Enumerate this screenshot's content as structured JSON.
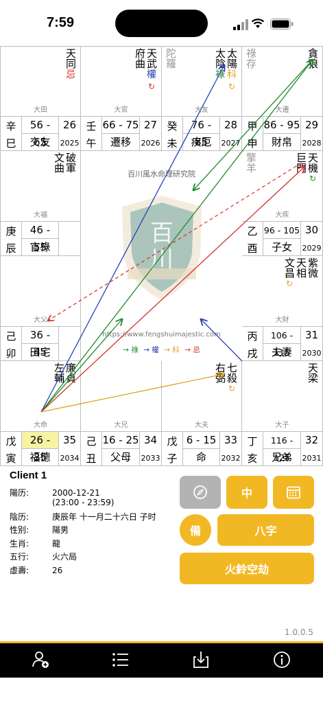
{
  "status": {
    "time": "7:59"
  },
  "center": {
    "institute": "百川風水命理研究院",
    "url": "https://www.fengshuimajestic.com",
    "legend": [
      {
        "text": "→ 祿",
        "color": "#1f8a2a"
      },
      {
        "text": "→ 權",
        "color": "#2740b8"
      },
      {
        "text": "→ 科",
        "color": "#e0a020"
      },
      {
        "text": "→ 忌",
        "color": "#d0312d"
      }
    ]
  },
  "palaces": {
    "si": {
      "stars": [
        {
          "ch": "天同",
          "mod": "忌",
          "modc": "ji"
        }
      ],
      "minor": [],
      "da": "大田",
      "gan": "辛",
      "zhi": "巳",
      "range": "56 - 65",
      "age": "26",
      "name": "交友",
      "year": "2025"
    },
    "wu": {
      "stars": [
        {
          "ch": "府曲",
          "mod": "",
          "modc": ""
        },
        {
          "ch": "天武",
          "mod": "權",
          "modc": "quan",
          "ref": "↻"
        }
      ],
      "minor": [],
      "da": "大官",
      "gan": "壬",
      "zhi": "午",
      "range": "66 - 75",
      "age": "27",
      "name": "遷移",
      "year": "2026"
    },
    "wei": {
      "stars": [
        {
          "ch": "太陰",
          "mod": "祿",
          "modc": "lu"
        },
        {
          "ch": "太陽",
          "mod": "科",
          "modc": "ke",
          "ref": "↻"
        }
      ],
      "minor": [
        {
          "ch": "陀羅"
        }
      ],
      "da": "大友",
      "gan": "癸",
      "zhi": "未",
      "range": "76 - 85",
      "age": "28",
      "name": "疾厄",
      "year": "2027"
    },
    "shen": {
      "stars": [
        {
          "ch": "貪狼",
          "mod": "",
          "modc": ""
        }
      ],
      "minor": [
        {
          "ch": "祿存"
        }
      ],
      "da": "大遷",
      "gan": "甲",
      "zhi": "申",
      "range": "86 - 95",
      "age": "29",
      "name": "財帛",
      "year": "2028"
    },
    "chen": {
      "stars": [
        {
          "ch": "文曲",
          "mod": "",
          "modc": ""
        },
        {
          "ch": "破軍",
          "mod": "",
          "modc": ""
        }
      ],
      "minor": [],
      "da": "大福",
      "gan": "庚",
      "zhi": "辰",
      "range": "46 - 55",
      "age": "",
      "name": "官祿",
      "year": ""
    },
    "you": {
      "stars": [
        {
          "ch": "巨門",
          "mod": "",
          "modc": ""
        },
        {
          "ch": "天機",
          "mod": "",
          "modc": "",
          "ref": "↻"
        }
      ],
      "minor": [
        {
          "ch": "擎羊"
        }
      ],
      "da": "大疾",
      "gan": "乙",
      "zhi": "酉",
      "range": "96 - 105",
      "age": "30",
      "name": "子女",
      "year": "2029"
    },
    "mao": {
      "stars": [],
      "minor": [],
      "da": "大父",
      "gan": "己",
      "zhi": "卯",
      "range": "36 - 45",
      "age": "",
      "name": "田宅",
      "year": ""
    },
    "xu": {
      "stars": [
        {
          "ch": "紫微",
          "mod": "",
          "modc": ""
        },
        {
          "ch": "天相",
          "mod": "",
          "modc": ""
        },
        {
          "ch": "文昌",
          "mod": "",
          "modc": "",
          "ref": "↻"
        }
      ],
      "minor": [],
      "da": "大財",
      "gan": "丙",
      "zhi": "戌",
      "range": "106 - 115",
      "age": "31",
      "name": "夫妻",
      "year": "2030"
    },
    "yin": {
      "stars": [
        {
          "ch": "廉貞",
          "mod": "",
          "modc": ""
        },
        {
          "ch": "左輔",
          "mod": "",
          "modc": ""
        }
      ],
      "minor": [],
      "da": "大命",
      "gan": "戊",
      "zhi": "寅",
      "range": "26 - 35",
      "age": "35",
      "name": "福德",
      "year": "2034"
    },
    "chou": {
      "stars": [],
      "minor": [],
      "da": "大兄",
      "gan": "己",
      "zhi": "丑",
      "range": "16 - 25",
      "age": "34",
      "name": "父母",
      "year": "2033"
    },
    "zi": {
      "stars": [
        {
          "ch": "七殺",
          "mod": "",
          "modc": ""
        },
        {
          "ch": "右弼",
          "mod": "",
          "modc": "",
          "ref": "↻"
        }
      ],
      "minor": [],
      "da": "大夫",
      "gan": "戊",
      "zhi": "子",
      "range": "6 - 15",
      "age": "33",
      "name": "命",
      "year": "2032"
    },
    "hai": {
      "stars": [
        {
          "ch": "天梁",
          "mod": "",
          "modc": ""
        }
      ],
      "minor": [],
      "da": "大子",
      "gan": "丁",
      "zhi": "亥",
      "range": "116 - 125",
      "age": "32",
      "name": "兄弟",
      "year": "2031"
    }
  },
  "client": {
    "name": "Client 1",
    "rows": [
      {
        "k": "陽历:",
        "v": "2000-12-21",
        "sub": "(23:00 - 23:59)"
      },
      {
        "k": "陰历:",
        "v": "庚辰年 十一月二十六日 子时"
      },
      {
        "k": "性别:",
        "v": "陽男"
      },
      {
        "k": "生肖:",
        "v": "龍"
      },
      {
        "k": "五行:",
        "v": "火六局"
      },
      {
        "k": "虛壽:",
        "v": "26"
      }
    ]
  },
  "buttons": {
    "zhong": "中",
    "bei": "備",
    "bazi": "八字",
    "huoling": "火鈴空劫"
  },
  "version": "1.0.0.5",
  "colors": {
    "accent": "#f2b824",
    "lu": "#1f8a2a",
    "quan": "#2740b8",
    "ke": "#e0a020",
    "ji": "#d0312d"
  }
}
